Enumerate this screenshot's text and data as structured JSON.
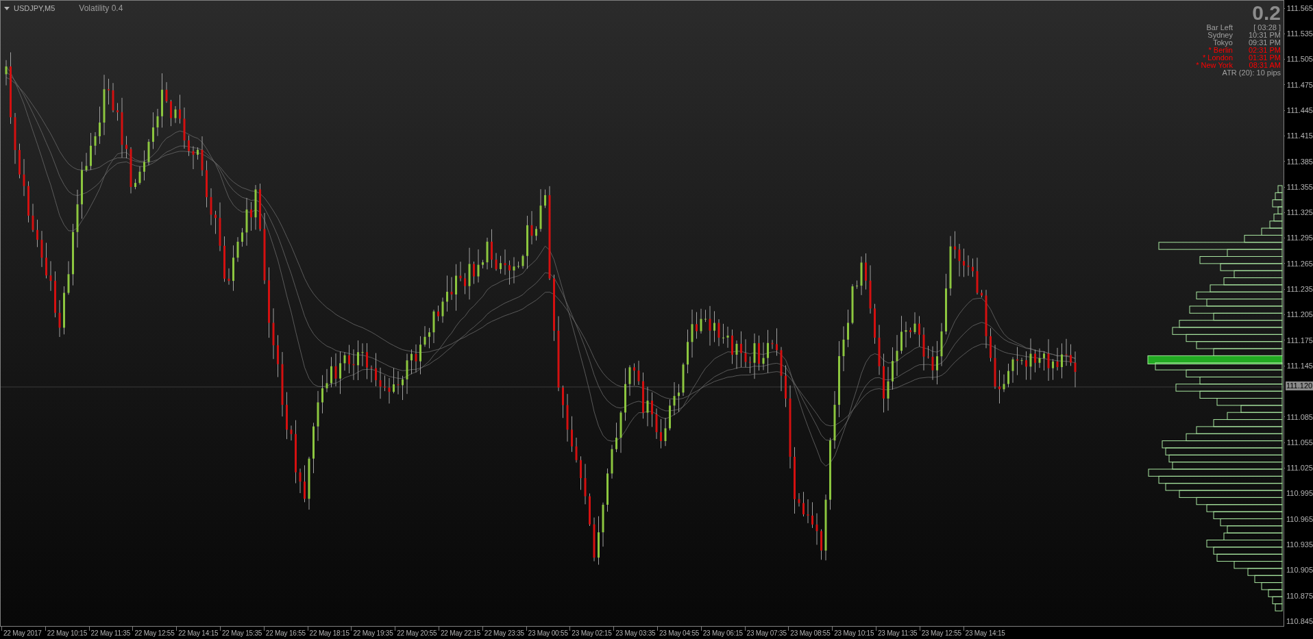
{
  "header": {
    "symbol": "USDJPY,M5",
    "indicator": "Volatility 0.4"
  },
  "info_panel": {
    "value": "0.2",
    "rows": [
      {
        "label": "Bar Left",
        "value": "[ 03:28 ]",
        "color": "#a0a0a0"
      },
      {
        "label": "Sydney",
        "value": "10:31 PM",
        "color": "#a0a0a0"
      },
      {
        "label": "Tokyo",
        "value": "09:31 PM",
        "color": "#a0a0a0"
      },
      {
        "label": "* Berlin",
        "value": "02:31 PM",
        "color": "#ff0000"
      },
      {
        "label": "* London",
        "value": "01:31 PM",
        "color": "#ff0000"
      },
      {
        "label": "* New York",
        "value": "08:31 AM",
        "color": "#ff0000"
      }
    ],
    "footer": "ATR (20): 10 pips"
  },
  "price_axis": {
    "labels": [
      {
        "text": "111.565",
        "kind": "tick"
      },
      {
        "text": "111.535",
        "kind": "tick"
      },
      {
        "text": "111.505",
        "kind": "tick"
      },
      {
        "text": "111.475",
        "kind": "tick"
      },
      {
        "text": "111.445",
        "kind": "tick"
      },
      {
        "text": "111.415",
        "kind": "tick"
      },
      {
        "text": "111.385",
        "kind": "tick"
      },
      {
        "text": "111.355",
        "kind": "tick"
      },
      {
        "text": "111.325",
        "kind": "tick"
      },
      {
        "text": "111.295",
        "kind": "tick"
      },
      {
        "text": "111.265",
        "kind": "tick"
      },
      {
        "text": "111.235",
        "kind": "tick"
      },
      {
        "text": "111.205",
        "kind": "tick"
      },
      {
        "text": "111.175",
        "kind": "tick"
      },
      {
        "text": "111.145",
        "kind": "tick"
      },
      {
        "text": "111.120",
        "kind": "current"
      },
      {
        "text": "111.085",
        "kind": "tick"
      },
      {
        "text": "111.055",
        "kind": "tick"
      },
      {
        "text": "111.025",
        "kind": "tick"
      },
      {
        "text": "110.995",
        "kind": "tick"
      },
      {
        "text": "110.965",
        "kind": "tick"
      },
      {
        "text": "110.935",
        "kind": "tick"
      },
      {
        "text": "110.905",
        "kind": "tick"
      },
      {
        "text": "110.875",
        "kind": "tick"
      },
      {
        "text": "110.845",
        "kind": "tick"
      }
    ]
  },
  "time_axis": {
    "labels": [
      "22 May 2017",
      "22 May 10:15",
      "22 May 11:35",
      "22 May 12:55",
      "22 May 14:15",
      "22 May 15:35",
      "22 May 16:55",
      "22 May 18:15",
      "22 May 19:35",
      "22 May 20:55",
      "22 May 22:15",
      "22 May 23:35",
      "23 May 00:55",
      "23 May 02:15",
      "23 May 03:35",
      "23 May 04:55",
      "23 May 06:15",
      "23 May 07:35",
      "23 May 08:55",
      "23 May 10:15",
      "23 May 11:35",
      "23 May 12:55",
      "23 May 14:15"
    ]
  }
}
